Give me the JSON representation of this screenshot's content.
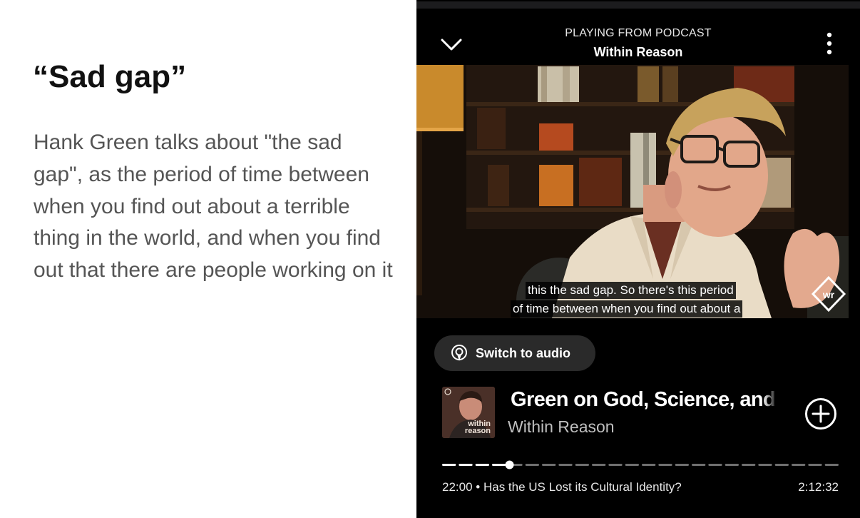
{
  "slide": {
    "title": "“Sad gap”",
    "body": "Hank Green talks about \"the sad gap\", as the period of time between when you find out about a terrible thing in the world, and when you find out that there are people working on it"
  },
  "player": {
    "header": {
      "subtitle": "PLAYING FROM PODCAST",
      "title": "Within Reason"
    },
    "video": {
      "subtitle_line1": "this the sad gap. So there's this period",
      "subtitle_line2": "of time between when you find out about a",
      "watermark": "wr"
    },
    "switch_label": "Switch to audio",
    "episode": {
      "title": "Green on God, Science, and",
      "show": "Within Reason",
      "artwork_label_line1": "within",
      "artwork_label_line2": "reason"
    },
    "progress": {
      "fraction": 0.17,
      "segments": 24
    },
    "meta": {
      "current": "22:00",
      "separator": "•",
      "chapter": "Has the US Lost its Cultural Identity?",
      "duration": "2:12:32"
    },
    "colors": {
      "background": "#000000",
      "pill": "#2a2a2a",
      "text": "#ffffff",
      "muted": "#bfbfbf"
    },
    "icons": [
      "chevron-down-icon",
      "more-vertical-icon",
      "podcast-icon",
      "plus-circle-icon"
    ]
  }
}
